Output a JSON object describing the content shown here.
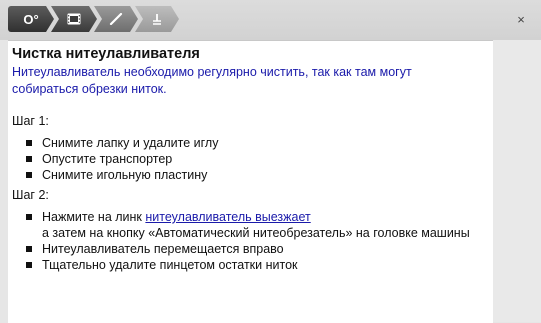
{
  "toolbar": {
    "crumb1_label": "O°",
    "crumb2_icon": "film-icon",
    "crumb3_icon": "needle-icon",
    "crumb4_icon": "thread-cutter-icon",
    "close_label": "×"
  },
  "article": {
    "title": "Чистка нитеулавливателя",
    "intro": "Нитеулавливатель необходимо регулярно чистить, так как там могут собираться обрезки ниток.",
    "step1_label": "Шаг 1:",
    "step1_items": [
      "Снимите лапку и удалите иглу",
      "Опустите транспортер",
      "Снимите игольную пластину"
    ],
    "step2_label": "Шаг 2:",
    "step2_item1_prefix": "Нажмите на линк ",
    "step2_item1_link": "нитеулавливатель выезжает",
    "step2_item1_suffix": "а затем на кнопку «Автоматический нитеобрезатель» на головке машины",
    "step2_item2": "Нитеулавливатель перемещается вправо",
    "step2_item3": "Тщательно удалите пинцетом остатки ниток"
  }
}
